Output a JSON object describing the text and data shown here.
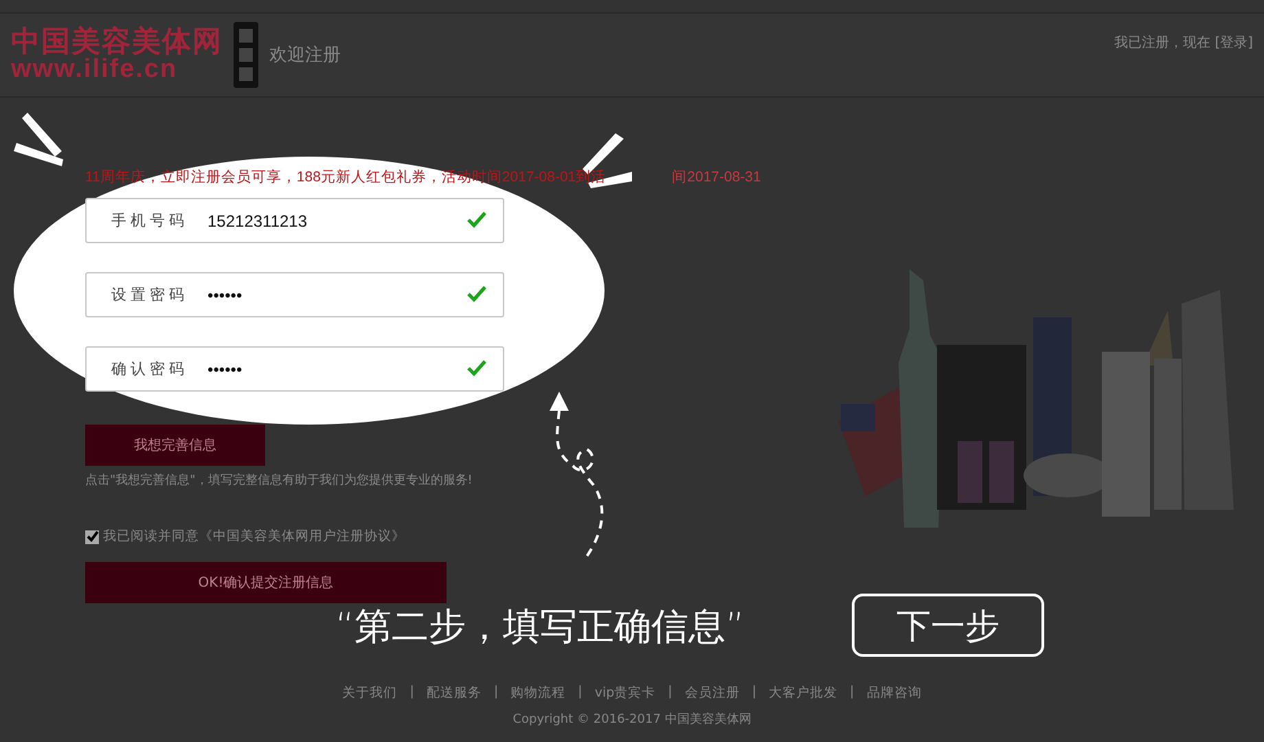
{
  "header": {
    "logo_title": "中国美容美体网",
    "logo_url": "www.ilife.cn",
    "page_title": "欢迎注册",
    "login_prompt": "我已注册，现在 [登录]"
  },
  "promo": {
    "text_before": "11周年庆，立即注册会员可享，188元新人红包礼券，活动时间2017-08-01到活",
    "text_after": "间2017-08-31"
  },
  "fields": [
    {
      "label": "手机号码",
      "value": "15212311213",
      "valid": true
    },
    {
      "label": "设置密码",
      "value": "••••••",
      "valid": true
    },
    {
      "label": "确认密码",
      "value": "••••••",
      "valid": true
    }
  ],
  "more_info_button": "我想完善信息",
  "hint": "点击\"我想完善信息\"，填写完整信息有助于我们为您提供更专业的服务!",
  "agreement": {
    "label": "我已阅读并同意《中国美容美体网用户注册协议》",
    "checked": true
  },
  "submit_button": "OK!确认提交注册信息",
  "tutorial": {
    "caption": "“第二步，填写正确信息”",
    "next_button": "下一步"
  },
  "footer": {
    "links": [
      "关于我们",
      "配送服务",
      "购物流程",
      "vip贵宾卡",
      "会员注册",
      "大客户批发",
      "品牌咨询"
    ],
    "separator": "|",
    "copyright": "Copyright © 2016-2017 中国美容美体网"
  }
}
